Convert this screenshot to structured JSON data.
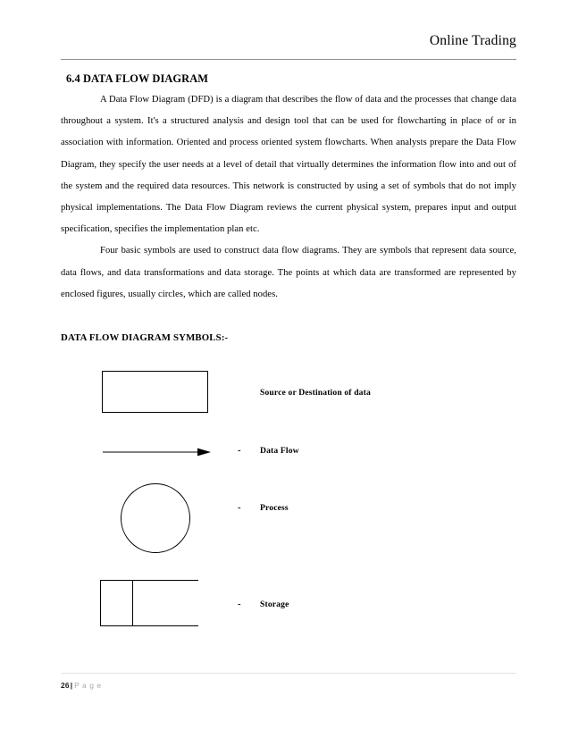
{
  "header": {
    "title": "Online Trading"
  },
  "main": {
    "section_heading": "6.4 DATA FLOW DIAGRAM",
    "paragraphs": [
      "A Data Flow Diagram (DFD) is a diagram that describes the flow of data and the processes that change data throughout a system. It's a structured analysis and design tool that can be used for flowcharting in place of or in association with information. Oriented and process oriented system flowcharts. When analysts prepare the Data Flow Diagram, they specify the user needs at a level of detail that virtually determines the information flow into and out of the system and the required data resources. This network is constructed by using a set of symbols that do not imply physical implementations. The Data Flow Diagram reviews the current physical system, prepares input and output specification, specifies the implementation plan etc.",
      "Four basic symbols are used to construct data flow diagrams. They are symbols that represent data source, data flows, and data transformations and data storage. The points at which data are transformed are represented by enclosed figures, usually circles, which are called nodes."
    ],
    "symbols_heading": "DATA FLOW DIAGRAM SYMBOLS:-",
    "symbols": [
      {
        "shape": "rectangle",
        "dash": "",
        "label": "Source or Destination of data"
      },
      {
        "shape": "arrow",
        "dash": "-",
        "label": "Data Flow"
      },
      {
        "shape": "circle",
        "dash": "-",
        "label": "Process"
      },
      {
        "shape": "open-rectangle",
        "dash": "-",
        "label": "Storage"
      }
    ]
  },
  "footer": {
    "page_number": "26",
    "separator": "|",
    "page_word": "P a g e"
  },
  "colors": {
    "text": "#000000",
    "header_rule": "#909090",
    "footer_rule": "#e2e2e2",
    "footer_word": "#a8a8a8"
  }
}
